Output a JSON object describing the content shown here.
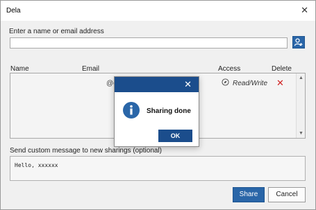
{
  "window": {
    "title": "Dela",
    "close_glyph": "✕"
  },
  "form": {
    "name_email_label": "Enter a name or email address",
    "name_email_value": "",
    "add_user_icon": "add-user-icon"
  },
  "table": {
    "headers": {
      "name": "Name",
      "email": "Email",
      "access": "Access",
      "delete": "Delete"
    },
    "rows": [
      {
        "name": "",
        "email": "@e",
        "access": "Read/Write",
        "delete_glyph": "✕"
      }
    ]
  },
  "message": {
    "label": "Send custom message to new sharings (optional)",
    "value": "Hello, xxxxxx"
  },
  "actions": {
    "share": "Share",
    "cancel": "Cancel"
  },
  "dialog": {
    "close_glyph": "✕",
    "text": "Sharing done",
    "ok": "OK",
    "info_icon": "info-icon"
  },
  "colors": {
    "primary": "#2a66a8",
    "dialog_header": "#1b4d8c",
    "delete": "#d02020"
  }
}
